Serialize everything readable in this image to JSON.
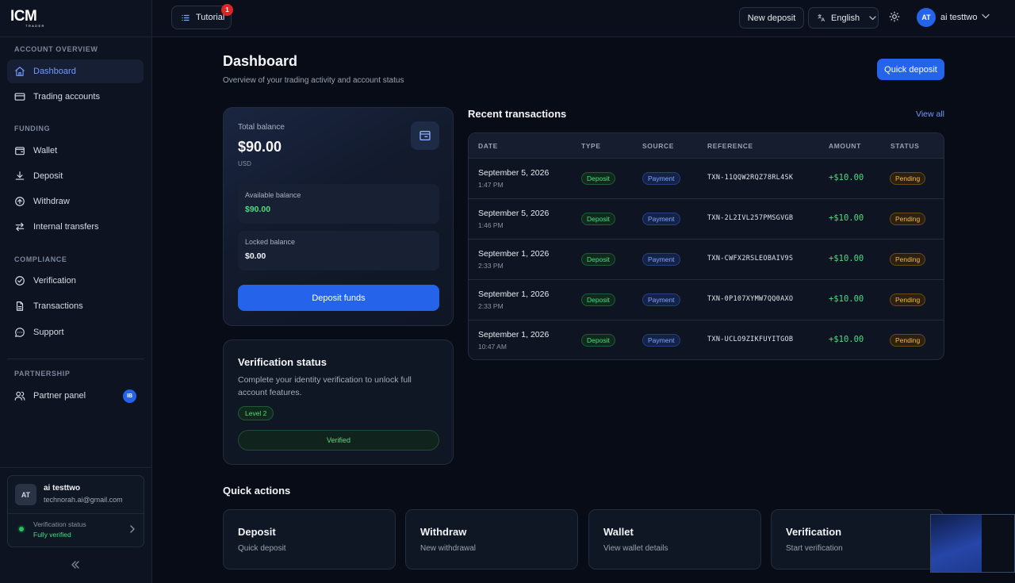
{
  "brand": {
    "logo": "ICM",
    "logo_sub": "TRADER"
  },
  "sidebar": {
    "sections": {
      "account_overview": "ACCOUNT OVERVIEW",
      "funding": "FUNDING",
      "compliance": "COMPLIANCE",
      "partnership": "PARTNERSHIP"
    },
    "items": {
      "dashboard": "Dashboard",
      "trading_accounts": "Trading accounts",
      "wallet": "Wallet",
      "deposit": "Deposit",
      "withdraw": "Withdraw",
      "internal_transfers": "Internal transfers",
      "verification": "Verification",
      "transactions": "Transactions",
      "support": "Support",
      "partner_panel": "Partner panel"
    },
    "partner_badge": "IB",
    "user": {
      "initials": "AT",
      "name": "ai testtwo",
      "email": "technorah.ai@gmail.com",
      "verification_label": "Verification status",
      "verification_value": "Fully verified"
    }
  },
  "topbar": {
    "tutorial_label": "Tutorial",
    "tutorial_badge": "1",
    "new_deposit": "New deposit",
    "language": "English",
    "user_initials": "AT",
    "username": "ai testtwo"
  },
  "page": {
    "title": "Dashboard",
    "subtitle": "Overview of your trading activity and account status",
    "quick_deposit": "Quick deposit"
  },
  "balance": {
    "label": "Total balance",
    "amount": "$90.00",
    "currency": "USD",
    "available_label": "Available balance",
    "available_value": "$90.00",
    "locked_label": "Locked balance",
    "locked_value": "$0.00",
    "deposit_button": "Deposit funds"
  },
  "verification": {
    "title": "Verification status",
    "description": "Complete your identity verification to unlock full account features.",
    "level": "Level 2",
    "status": "Verified"
  },
  "transactions": {
    "title": "Recent transactions",
    "view_all": "View all",
    "headers": [
      "DATE",
      "TYPE",
      "SOURCE",
      "REFERENCE",
      "AMOUNT",
      "STATUS"
    ],
    "rows": [
      {
        "date": "September 5, 2026",
        "time": "1:47 PM",
        "type": "Deposit",
        "source": "Payment",
        "reference": "TXN-11QQW2RQZ78RL4SK",
        "amount": "+$10.00",
        "status": "Pending"
      },
      {
        "date": "September 5, 2026",
        "time": "1:46 PM",
        "type": "Deposit",
        "source": "Payment",
        "reference": "TXN-2L2IVL257PMSGVGB",
        "amount": "+$10.00",
        "status": "Pending"
      },
      {
        "date": "September 1, 2026",
        "time": "2:33 PM",
        "type": "Deposit",
        "source": "Payment",
        "reference": "TXN-CWFX2RSLEOBAIV9S",
        "amount": "+$10.00",
        "status": "Pending"
      },
      {
        "date": "September 1, 2026",
        "time": "2:33 PM",
        "type": "Deposit",
        "source": "Payment",
        "reference": "TXN-0P107XYMW7QQ0AXO",
        "amount": "+$10.00",
        "status": "Pending"
      },
      {
        "date": "September 1, 2026",
        "time": "10:47 AM",
        "type": "Deposit",
        "source": "Payment",
        "reference": "TXN-UCLO9ZIKFUYITGOB",
        "amount": "+$10.00",
        "status": "Pending"
      }
    ]
  },
  "quick_actions": {
    "title": "Quick actions",
    "items": [
      {
        "name": "Deposit",
        "sub": "Quick deposit"
      },
      {
        "name": "Withdraw",
        "sub": "New withdrawal"
      },
      {
        "name": "Wallet",
        "sub": "View wallet details"
      },
      {
        "name": "Verification",
        "sub": "Start verification"
      }
    ]
  },
  "colors": {
    "accent": "#2563eb",
    "success": "#4ade80",
    "warning": "#f5b84a",
    "background": "#080c17"
  }
}
